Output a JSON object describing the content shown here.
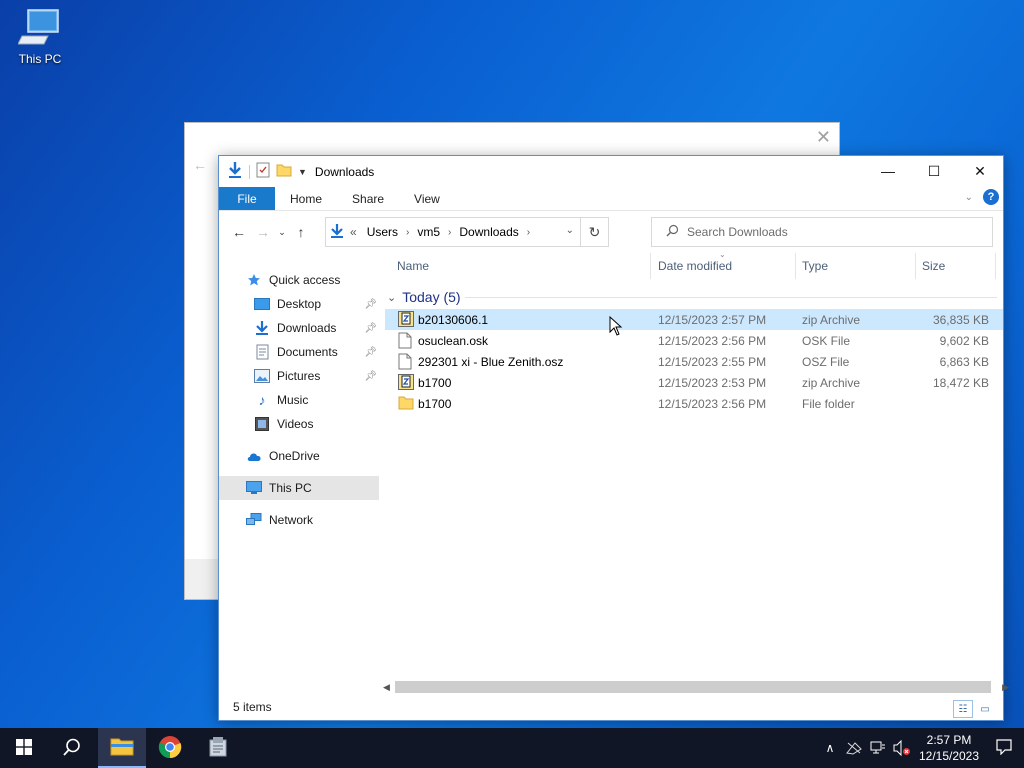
{
  "desktop": {
    "icon_label": "This PC"
  },
  "window": {
    "title": "Downloads",
    "controls": {
      "minimize": "—",
      "maximize": "☐",
      "close": "✕"
    },
    "ribbon_tabs": [
      "File",
      "Home",
      "Share",
      "View"
    ],
    "address": {
      "prefix": "«",
      "segments": [
        "Users",
        "vm5",
        "Downloads"
      ]
    },
    "search_placeholder": "Search Downloads",
    "nav_pane": [
      {
        "label": "Quick access",
        "icon": "star-icon"
      },
      {
        "label": "Desktop",
        "icon": "desktop-icon",
        "pinned": true
      },
      {
        "label": "Downloads",
        "icon": "download-icon",
        "pinned": true
      },
      {
        "label": "Documents",
        "icon": "documents-icon",
        "pinned": true
      },
      {
        "label": "Pictures",
        "icon": "pictures-icon",
        "pinned": true
      },
      {
        "label": "Music",
        "icon": "music-icon"
      },
      {
        "label": "Videos",
        "icon": "videos-icon"
      },
      {
        "label": "OneDrive",
        "icon": "cloud-icon"
      },
      {
        "label": "This PC",
        "icon": "pc-icon",
        "selected": true
      },
      {
        "label": "Network",
        "icon": "network-icon"
      }
    ],
    "columns": {
      "name": "Name",
      "date": "Date modified",
      "type": "Type",
      "size": "Size"
    },
    "group_label": "Today (5)",
    "files": [
      {
        "name": "b20130606.1",
        "date": "12/15/2023 2:57 PM",
        "type": "zip Archive",
        "size": "36,835 KB",
        "icon": "zip-icon",
        "selected": true
      },
      {
        "name": "osuclean.osk",
        "date": "12/15/2023 2:56 PM",
        "type": "OSK File",
        "size": "9,602 KB",
        "icon": "file-icon"
      },
      {
        "name": "292301 xi - Blue Zenith.osz",
        "date": "12/15/2023 2:55 PM",
        "type": "OSZ File",
        "size": "6,863 KB",
        "icon": "file-icon"
      },
      {
        "name": "b1700",
        "date": "12/15/2023 2:53 PM",
        "type": "zip Archive",
        "size": "18,472 KB",
        "icon": "zip-icon"
      },
      {
        "name": "b1700",
        "date": "12/15/2023 2:56 PM",
        "type": "File folder",
        "size": "",
        "icon": "folder-icon"
      }
    ],
    "status": "5 items"
  },
  "taskbar": {
    "clock_time": "2:57 PM",
    "clock_date": "12/15/2023"
  },
  "colors": {
    "accent": "#1979ca",
    "selection": "#cce8ff",
    "taskbar": "#101626",
    "group_header": "#1e3287"
  }
}
